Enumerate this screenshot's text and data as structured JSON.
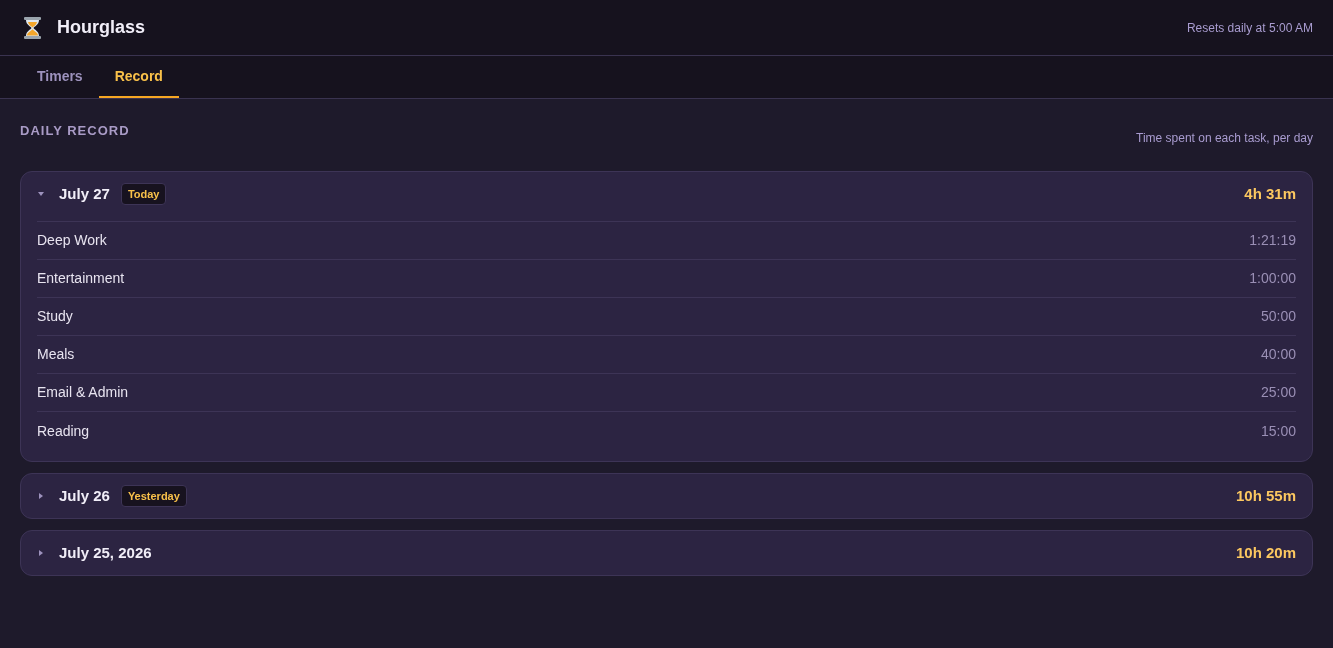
{
  "app": {
    "title": "Hourglass",
    "reset_note": "Resets daily at 5:00 AM"
  },
  "tabs": [
    {
      "label": "Timers",
      "selected": false
    },
    {
      "label": "Record",
      "selected": true
    }
  ],
  "section": {
    "title": "DAILY RECORD",
    "subtitle": "Time spent on each task, per day"
  },
  "days": [
    {
      "date": "July 27",
      "badge": "Today",
      "total": "4h 31m",
      "expanded": true,
      "tasks": [
        {
          "name": "Deep Work",
          "time": "1:21:19"
        },
        {
          "name": "Entertainment",
          "time": "1:00:00"
        },
        {
          "name": "Study",
          "time": "50:00"
        },
        {
          "name": "Meals",
          "time": "40:00"
        },
        {
          "name": "Email & Admin",
          "time": "25:00"
        },
        {
          "name": "Reading",
          "time": "15:00"
        }
      ]
    },
    {
      "date": "July 26",
      "badge": "Yesterday",
      "total": "10h 55m",
      "expanded": false
    },
    {
      "date": "July 25, 2026",
      "total": "10h 20m",
      "expanded": false
    }
  ]
}
